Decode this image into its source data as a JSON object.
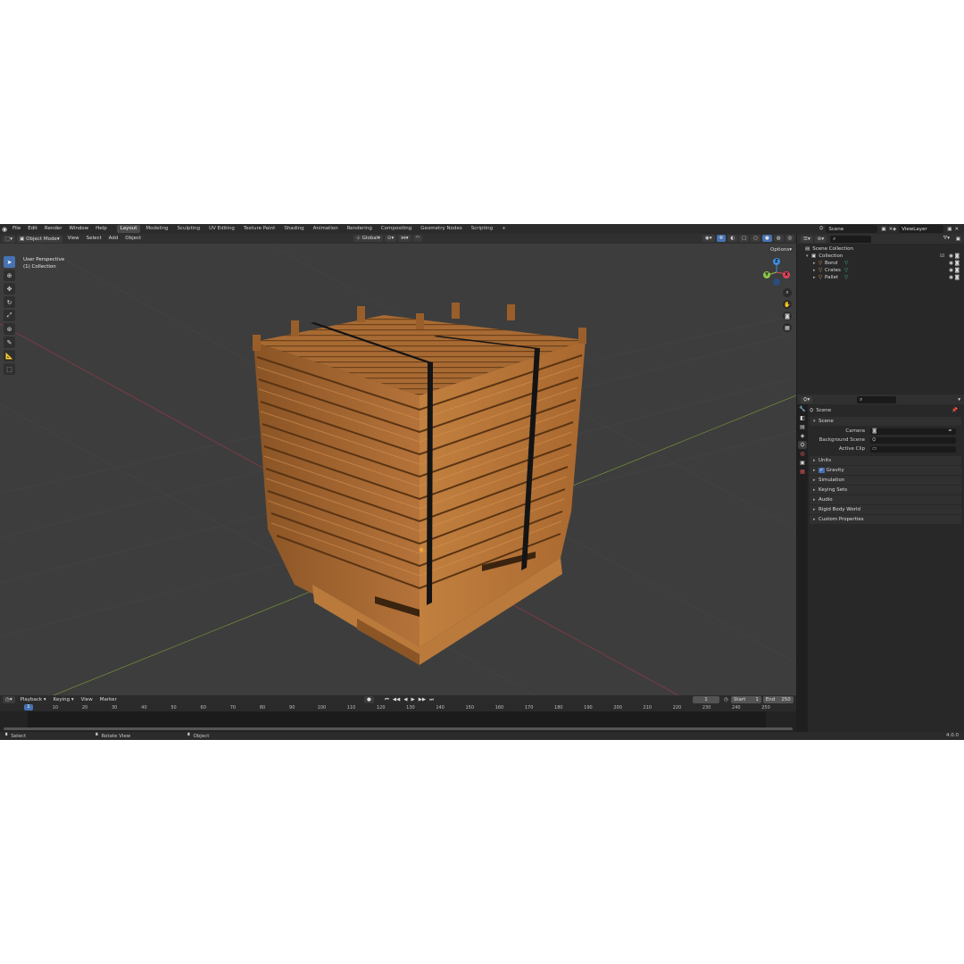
{
  "menubar": {
    "menus": [
      "File",
      "Edit",
      "Render",
      "Window",
      "Help"
    ],
    "workspaces": [
      "Layout",
      "Modeling",
      "Sculpting",
      "UV Editing",
      "Texture Paint",
      "Shading",
      "Animation",
      "Rendering",
      "Compositing",
      "Geometry Nodes",
      "Scripting"
    ],
    "active_workspace": "Layout",
    "add_tab": "+",
    "scene": "Scene",
    "view_layer": "ViewLayer"
  },
  "viewport_header": {
    "mode": "Object Mode",
    "menus": [
      "View",
      "Select",
      "Add",
      "Object"
    ],
    "transform_orientation": "Global",
    "options": "Options"
  },
  "viewport": {
    "perspective": "User Perspective",
    "collection": "(1) Collection",
    "gizmo": {
      "x": "X",
      "y": "Y",
      "z": "Z"
    }
  },
  "timeline": {
    "menus": [
      "Playback",
      "Keying",
      "View",
      "Marker"
    ],
    "current_frame": "1",
    "start_label": "Start",
    "start": "1",
    "end_label": "End",
    "end": "250",
    "ticks": [
      "10",
      "20",
      "30",
      "40",
      "50",
      "60",
      "70",
      "80",
      "90",
      "100",
      "110",
      "120",
      "130",
      "140",
      "150",
      "160",
      "170",
      "180",
      "190",
      "200",
      "210",
      "220",
      "230",
      "240",
      "250"
    ],
    "playhead": "1"
  },
  "statusbar": {
    "select": "Select",
    "rotate": "Rotate View",
    "object": "Object",
    "version": "4.0.0"
  },
  "outliner": {
    "root": "Scene Collection",
    "collection": "Collection",
    "objects": [
      "Bond",
      "Crates",
      "Pallet"
    ]
  },
  "properties": {
    "context": "Scene",
    "panel_scene": "Scene",
    "camera_label": "Camera",
    "background_label": "Background Scene",
    "clip_label": "Active Clip",
    "panels": [
      "Units",
      "Gravity",
      "Simulation",
      "Keying Sets",
      "Audio",
      "Rigid Body World",
      "Custom Properties"
    ]
  },
  "colors": {
    "accent": "#4772b3",
    "wood": "#b8743a",
    "strap": "#111111",
    "axis_x": "#e0445c",
    "axis_y": "#8bc34a",
    "axis_z": "#3d8ee0"
  }
}
